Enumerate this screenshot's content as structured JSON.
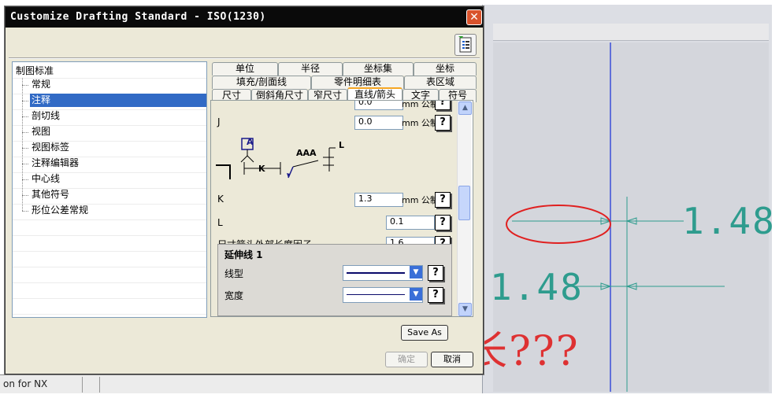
{
  "dialog": {
    "title": "Customize Drafting Standard - ISO(1230)",
    "close_label": "✕"
  },
  "tree": {
    "root": "制图标准",
    "items": [
      "常规",
      "注释",
      "剖切线",
      "视图",
      "视图标签",
      "注释编辑器",
      "中心线",
      "其他符号",
      "形位公差常规"
    ],
    "selected": "注释"
  },
  "tabs": {
    "row1": [
      "单位",
      "半径",
      "坐标集",
      "坐标"
    ],
    "row2": [
      "填充/剖面线",
      "零件明细表",
      "表区域"
    ],
    "row3": [
      "尺寸",
      "倒斜角尺寸",
      "窄尺寸",
      "直线/箭头",
      "文字",
      "符号"
    ],
    "active": "直线/箭头"
  },
  "panel": {
    "fields": [
      {
        "label": "J",
        "value": "0.0",
        "unit": "mm 公制"
      },
      {
        "label": "K",
        "value": "1.3",
        "unit": "mm 公制"
      },
      {
        "label": "L",
        "value": "0.1",
        "unit": ""
      },
      {
        "label": "尺寸箭头外部长度因子",
        "value": "1.6",
        "unit": ""
      }
    ],
    "top_partial": {
      "value": "0.0",
      "unit": "mm 公制"
    },
    "diagram": {
      "box_letter": "A",
      "text": "AAA",
      "k_label": "K",
      "l_label": "L"
    },
    "ext_group": {
      "title": "延伸线 1",
      "line_type_label": "线型",
      "width_label": "宽度"
    },
    "help_glyph": "?"
  },
  "buttons": {
    "save_as": "Save As",
    "ok": "确定",
    "cancel": "取消"
  },
  "background": {
    "dimension_value": "1.48",
    "annotation": "还是那么长???",
    "taskbar_text": "on for NX"
  },
  "colors": {
    "dim_teal": "#2e9c8e",
    "annotation_red": "#e02020",
    "guide_blue": "#3a4fd8",
    "selection": "#316ac5"
  }
}
